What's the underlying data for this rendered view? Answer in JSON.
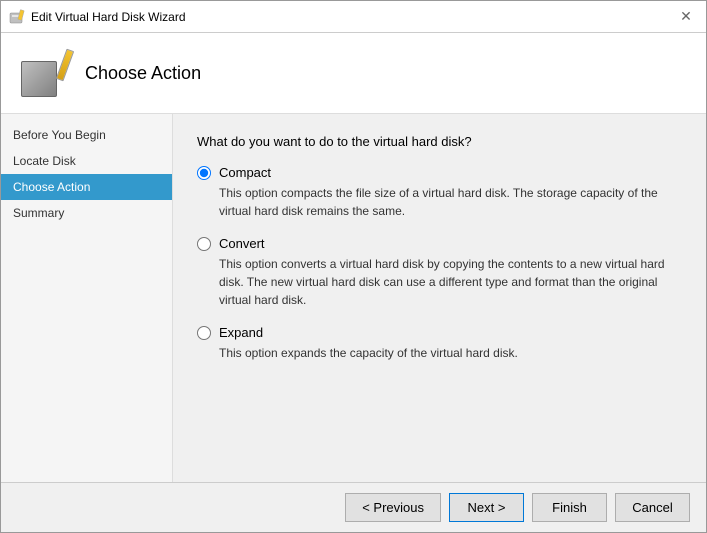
{
  "window": {
    "title": "Edit Virtual Hard Disk Wizard",
    "close_label": "✕"
  },
  "header": {
    "title": "Choose Action"
  },
  "sidebar": {
    "items": [
      {
        "id": "before-you-begin",
        "label": "Before You Begin",
        "active": false
      },
      {
        "id": "locate-disk",
        "label": "Locate Disk",
        "active": false
      },
      {
        "id": "choose-action",
        "label": "Choose Action",
        "active": true
      },
      {
        "id": "summary",
        "label": "Summary",
        "active": false
      }
    ]
  },
  "main": {
    "question": "What do you want to do to the virtual hard disk?",
    "options": [
      {
        "id": "compact",
        "label": "Compact",
        "description": "This option compacts the file size of a virtual hard disk. The storage capacity of the virtual hard disk remains the same.",
        "checked": true
      },
      {
        "id": "convert",
        "label": "Convert",
        "description": "This option converts a virtual hard disk by copying the contents to a new virtual hard disk. The new virtual hard disk can use a different type and format than the original virtual hard disk.",
        "checked": false
      },
      {
        "id": "expand",
        "label": "Expand",
        "description": "This option expands the capacity of the virtual hard disk.",
        "checked": false
      }
    ]
  },
  "footer": {
    "previous_label": "< Previous",
    "next_label": "Next >",
    "finish_label": "Finish",
    "cancel_label": "Cancel"
  }
}
